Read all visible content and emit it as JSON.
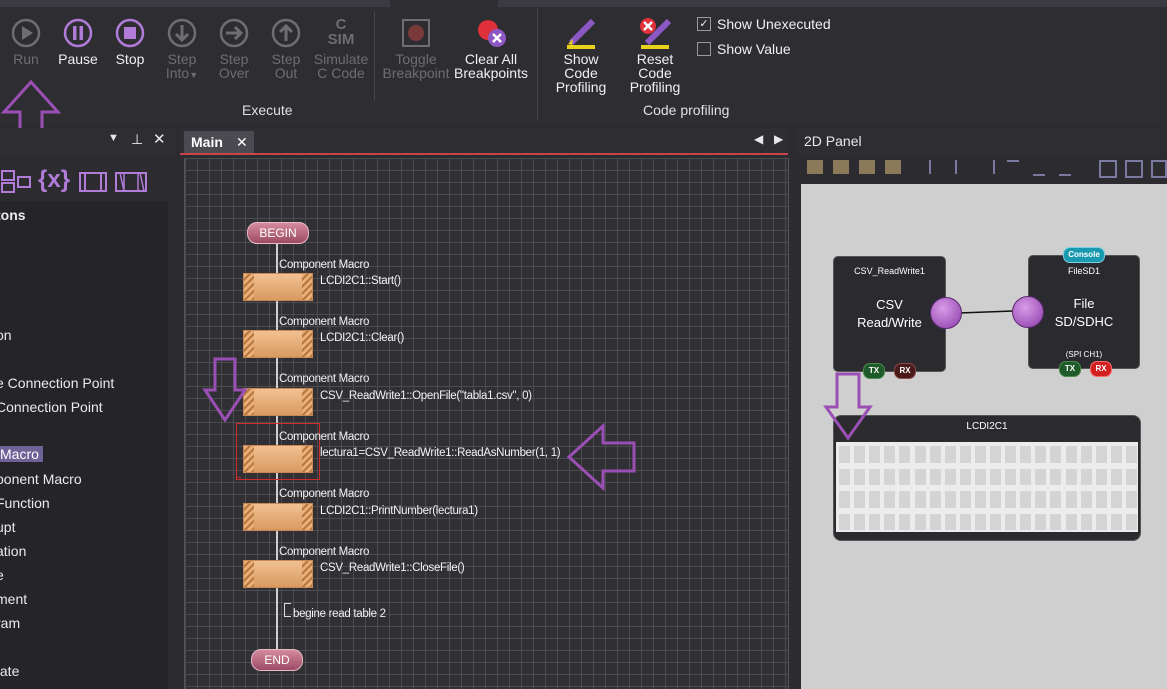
{
  "ribbon": {
    "execute": {
      "group_label": "Execute",
      "run": "Run",
      "pause": "Pause",
      "stop": "Stop",
      "step_into_1": "Step",
      "step_into_2": "Into",
      "step_over_1": "Step",
      "step_over_2": "Over",
      "step_out_1": "Step",
      "step_out_2": "Out",
      "simulate_1": "Simulate",
      "simulate_2": "C Code",
      "sim_icon_text": "C\nSIM",
      "toggle_bp_1": "Toggle",
      "toggle_bp_2": "Breakpoint",
      "clear_bp_1": "Clear All",
      "clear_bp_2": "Breakpoints"
    },
    "profiling": {
      "group_label": "Code profiling",
      "show_1": "Show Code",
      "show_2": "Profiling",
      "reset_1": "Reset Code",
      "reset_2": "Profiling",
      "show_unexecuted": "Show Unexecuted",
      "show_unexecuted_checked": true,
      "show_value": "Show Value",
      "show_value_checked": false
    }
  },
  "left_panel": {
    "header_fragment": "tons",
    "items": [
      {
        "label": "t"
      },
      {
        "label": "on"
      },
      {
        "label": "e Connection Point"
      },
      {
        "label": "Connection Point"
      },
      {
        "label": "Macro",
        "selected": true
      },
      {
        "label": "ponent Macro"
      },
      {
        "label": "Function"
      },
      {
        "label": "upt"
      },
      {
        "label": "ation"
      },
      {
        "label": "e"
      },
      {
        "label": "ment"
      },
      {
        "label": "ram"
      },
      {
        "label": "tate"
      }
    ]
  },
  "main_tab": {
    "label": "Main",
    "close": "✕"
  },
  "flowchart": {
    "begin": "BEGIN",
    "end": "END",
    "blocks": [
      {
        "type": "Component Macro",
        "call": "LCDI2C1::Start()"
      },
      {
        "type": "Component Macro",
        "call": "LCDI2C1::Clear()"
      },
      {
        "type": "Component Macro",
        "call": "CSV_ReadWrite1::OpenFile(\"tabla1.csv\", 0)"
      },
      {
        "type": "Component Macro",
        "call": "lectura1=CSV_ReadWrite1::ReadAsNumber(1, 1)"
      },
      {
        "type": "Component Macro",
        "call": "LCDI2C1::PrintNumber(lectura1)"
      },
      {
        "type": "Component Macro",
        "call": "CSV_ReadWrite1::CloseFile()"
      }
    ],
    "comment": "begine read table 2"
  },
  "panel_2d": {
    "title": "2D Panel",
    "csv": {
      "name": "CSV_ReadWrite1",
      "line1": "CSV",
      "line2": "Read/Write",
      "tx": "TX",
      "rx": "RX"
    },
    "file": {
      "badge": "Console",
      "name": "FileSD1",
      "line1": "File",
      "line2": "SD/SDHC",
      "bus": "(SPI CH1)",
      "tx": "TX",
      "rx": "RX"
    },
    "lcd": {
      "name": "LCDI2C1",
      "rows": 4,
      "cols": 20
    }
  },
  "colors": {
    "accent": "#c8434a",
    "annotation": "#9b4fb4",
    "selection": "#6e6296"
  }
}
